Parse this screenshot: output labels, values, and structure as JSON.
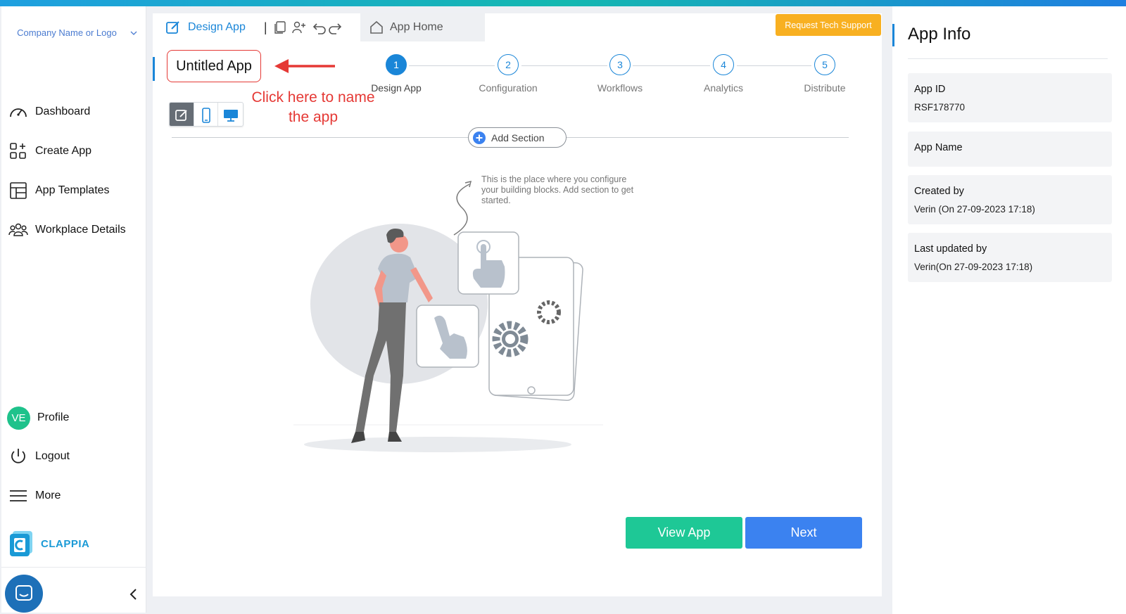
{
  "sidebar": {
    "company": "Company Name or Logo",
    "nav": [
      {
        "label": "Dashboard",
        "icon": "dashboard-icon"
      },
      {
        "label": "Create App",
        "icon": "create-app-icon"
      },
      {
        "label": "App Templates",
        "icon": "templates-icon"
      },
      {
        "label": "Workplace Details",
        "icon": "team-icon"
      }
    ],
    "profile": {
      "initials": "VE",
      "label": "Profile"
    },
    "logout": "Logout",
    "more": "More",
    "brand": "CLAPPIA"
  },
  "tabs": {
    "design": "Design App",
    "home": "App Home"
  },
  "tech_support": "Request Tech Support",
  "app_name": "Untitled App",
  "annotation": "Click here to name the app",
  "steps": [
    {
      "n": "1",
      "label": "Design App",
      "active": true
    },
    {
      "n": "2",
      "label": "Configuration"
    },
    {
      "n": "3",
      "label": "Workflows"
    },
    {
      "n": "4",
      "label": "Analytics"
    },
    {
      "n": "5",
      "label": "Distribute"
    }
  ],
  "add_section": "Add Section",
  "empty_hint": "This is the place where you configure your building blocks. Add section to get started.",
  "buttons": {
    "view": "View App",
    "next": "Next"
  },
  "app_info": {
    "title": "App Info",
    "fields": [
      {
        "label": "App ID",
        "value": "RSF178770"
      },
      {
        "label": "App Name",
        "value": ""
      },
      {
        "label": "Created by",
        "value": "Verin (On 27-09-2023 17:18)"
      },
      {
        "label": "Last updated by",
        "value": "Verin(On 27-09-2023 17:18)"
      }
    ]
  },
  "colors": {
    "accent": "#1a86d8",
    "warning": "#f8b021",
    "success": "#1ec896",
    "primary": "#3b82f0",
    "annotation": "#e53935"
  }
}
